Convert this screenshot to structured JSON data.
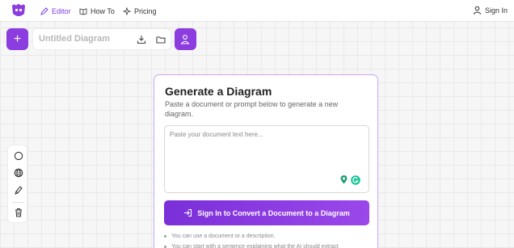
{
  "nav": {
    "items": [
      {
        "label": "Editor"
      },
      {
        "label": "How To"
      },
      {
        "label": "Pricing"
      }
    ],
    "sign_in": "Sign In"
  },
  "editor": {
    "title_placeholder": "Untitled Diagram",
    "add_label": "+"
  },
  "panel": {
    "title": "Generate a Diagram",
    "subtitle": "Paste a document or prompt below to generate a new diagram.",
    "textarea_placeholder": "Paste your document text here...",
    "convert_button": "Sign In to Convert a Document to a Diagram",
    "tips": [
      "You can use a document or a description.",
      "You can start with a sentence explaining what the AI should extract"
    ]
  },
  "colors": {
    "accent": "#8b3ddf",
    "active_nav": "#7c3aed"
  }
}
